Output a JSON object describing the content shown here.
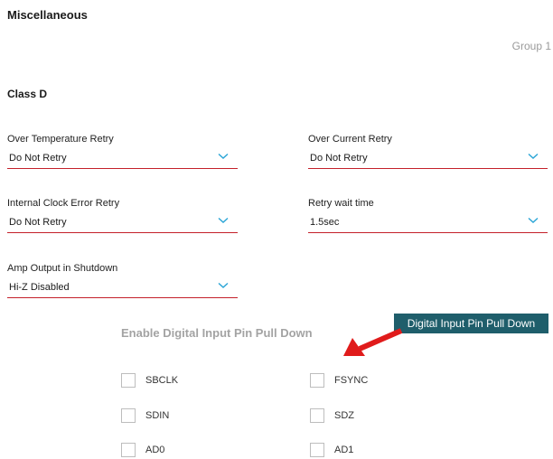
{
  "page": {
    "title": "Miscellaneous",
    "group_label": "Group 1"
  },
  "class_d": {
    "title": "Class D",
    "fields": [
      {
        "label": "Over Temperature Retry",
        "value": "Do Not Retry"
      },
      {
        "label": "Over Current Retry",
        "value": "Do Not Retry"
      },
      {
        "label": "Internal Clock Error Retry",
        "value": "Do Not Retry"
      },
      {
        "label": "Retry wait time",
        "value": "1.5sec"
      },
      {
        "label": "Amp Output in Shutdown",
        "value": "Hi-Z Disabled"
      }
    ]
  },
  "pulldown": {
    "heading": "Enable Digital Input Pin Pull Down",
    "tooltip": "Digital Input Pin Pull Down",
    "pins": [
      {
        "label": "SBCLK",
        "checked": false
      },
      {
        "label": "FSYNC",
        "checked": false
      },
      {
        "label": "SDIN",
        "checked": false
      },
      {
        "label": "SDZ",
        "checked": false
      },
      {
        "label": "AD0",
        "checked": false
      },
      {
        "label": "AD1",
        "checked": false
      }
    ]
  },
  "colors": {
    "accent_underline": "#c4202a",
    "chevron": "#2aa5d6",
    "tooltip_bg": "#1f5e6b",
    "arrow": "#e01b1b",
    "muted_heading": "#a3a3a3"
  },
  "icons": {
    "dropdown": "chevron-down-icon",
    "annotation": "red-arrow-icon"
  }
}
